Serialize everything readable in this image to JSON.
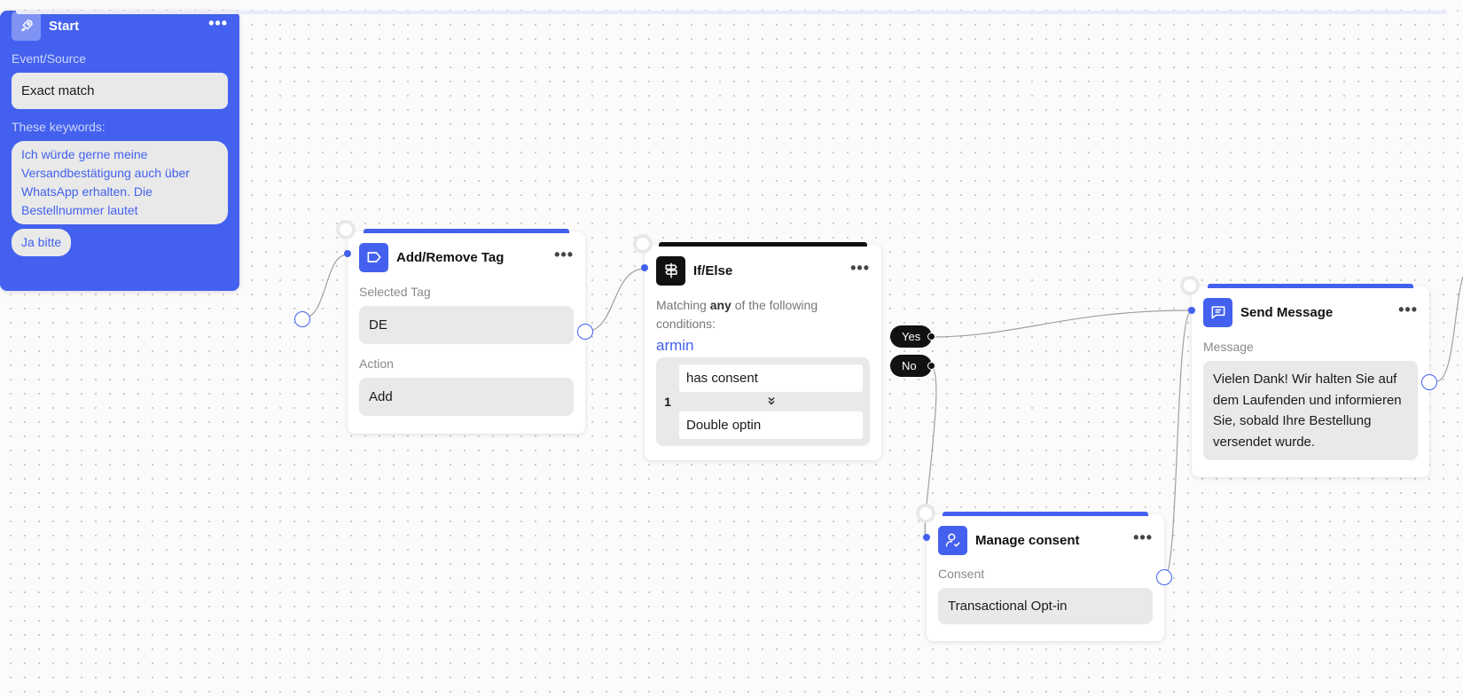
{
  "colors": {
    "accent": "#4361ee",
    "ifelse_accent": "#111111",
    "field_bg": "#e9e9e9"
  },
  "start": {
    "title": "Start",
    "icon": "rocket-icon",
    "event_label": "Event/Source",
    "event_value": "Exact match",
    "keywords_label": "These keywords:",
    "keywords": [
      "Ich würde gerne meine Versandbestätigung auch über WhatsApp erhalten. Die Bestellnummer lautet",
      "Ja bitte"
    ]
  },
  "tag_node": {
    "title": "Add/Remove Tag",
    "icon": "tag-icon",
    "tag_label": "Selected Tag",
    "tag_value": "DE",
    "action_label": "Action",
    "action_value": "Add"
  },
  "ifelse": {
    "title": "If/Else",
    "icon": "signpost-icon",
    "matching_prefix": "Matching",
    "matching_bold": "any",
    "matching_suffix": "of the following conditions:",
    "contact": "armin",
    "condition_number": "1",
    "condition_field": "has consent",
    "condition_operator_icon": "chevron-double-down-icon",
    "condition_value": "Double optin",
    "yes_label": "Yes",
    "no_label": "No"
  },
  "send_message": {
    "title": "Send Message",
    "icon": "chat-bubble-icon",
    "message_label": "Message",
    "message_value": "Vielen Dank! Wir halten Sie auf dem Laufenden und informieren Sie, sobald Ihre Bestellung versendet wurde."
  },
  "consent_node": {
    "title": "Manage consent",
    "icon": "user-check-icon",
    "consent_label": "Consent",
    "consent_value": "Transactional Opt-in"
  }
}
